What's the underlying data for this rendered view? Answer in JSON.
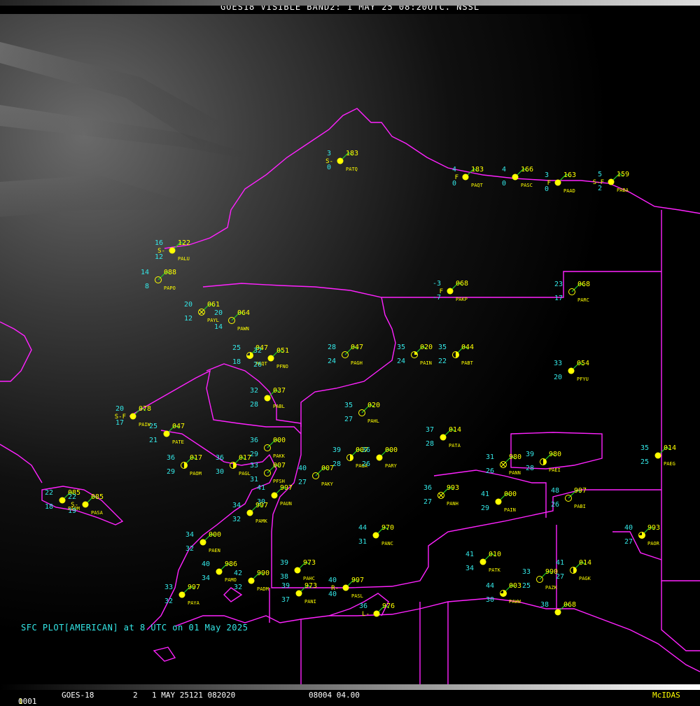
{
  "header": {
    "title": "GOES18  VISIBLE BAND2: 1 MAY 25 08:20UTC.  NSSL"
  },
  "caption": "SFC PLOT[AMERICAN] at 8 UTC on 01 May 2025",
  "status": {
    "frame": "0001",
    "satellite": "GOES-18",
    "band": "2",
    "date": "1 MAY 25121 082020",
    "time": "08004 04.00",
    "brand": "McIDAS"
  },
  "colors": {
    "temperature": "#34e8e8",
    "dewpoint": "#34e8e8",
    "pressure": "#ffff00",
    "station_id": "#ffff00",
    "wind_barb": "#22d022",
    "boundary": "#ff22ff",
    "station_dot": "#ffff00"
  },
  "stations": [
    {
      "id": "PATQ",
      "temp": "3",
      "dew": "0",
      "pres": "183",
      "wx": "S-",
      "cover": "full"
    },
    {
      "id": "PAQT",
      "temp": "4",
      "dew": "0",
      "pres": "183",
      "wx": "F",
      "cover": "full"
    },
    {
      "id": "PASC",
      "temp": "4",
      "dew": "0",
      "pres": "166",
      "wx": "",
      "cover": "full"
    },
    {
      "id": "PAAD",
      "temp": "3",
      "dew": "0",
      "pres": "163",
      "wx": "F",
      "cover": "full"
    },
    {
      "id": "PABA",
      "temp": "5",
      "dew": "2",
      "pres": "159",
      "wx": "S-F",
      "cover": "full"
    },
    {
      "id": "PALU",
      "temp": "16",
      "dew": "12",
      "pres": "122",
      "wx": "S-",
      "cover": "full"
    },
    {
      "id": "PAPO",
      "temp": "14",
      "dew": "8",
      "pres": "088",
      "wx": "",
      "cover": "empty"
    },
    {
      "id": "PAKP",
      "temp": "-3",
      "dew": "-7",
      "pres": "068",
      "wx": "F",
      "cover": "full"
    },
    {
      "id": "PARC",
      "temp": "23",
      "dew": "17",
      "pres": "068",
      "wx": "",
      "cover": "empty"
    },
    {
      "id": "PAYL",
      "temp": "20",
      "dew": "12",
      "pres": "061",
      "wx": "",
      "cover": "x"
    },
    {
      "id": "PAWN",
      "temp": "20",
      "dew": "14",
      "pres": "064",
      "wx": "",
      "cover": "empty"
    },
    {
      "id": "PAQT",
      "temp": "25",
      "dew": "18",
      "pres": "047",
      "wx": "",
      "cover": "three"
    },
    {
      "id": "PFNO",
      "temp": "32",
      "dew": "26",
      "pres": "051",
      "wx": "",
      "cover": "full"
    },
    {
      "id": "PAGH",
      "temp": "28",
      "dew": "24",
      "pres": "047",
      "wx": "",
      "cover": "empty"
    },
    {
      "id": "PAIN",
      "temp": "35",
      "dew": "24",
      "pres": "020",
      "wx": "",
      "cover": "quarter"
    },
    {
      "id": "PABT",
      "temp": "35",
      "dew": "22",
      "pres": "044",
      "wx": "",
      "cover": "half"
    },
    {
      "id": "PFYU",
      "temp": "33",
      "dew": "20",
      "pres": "054",
      "wx": "",
      "cover": "full"
    },
    {
      "id": "PABL",
      "temp": "32",
      "dew": "28",
      "pres": "037",
      "wx": "",
      "cover": "full"
    },
    {
      "id": "PAHL",
      "temp": "35",
      "dew": "27",
      "pres": "020",
      "wx": "",
      "cover": "empty"
    },
    {
      "id": "PAIW",
      "temp": "20",
      "dew": "17",
      "pres": "078",
      "wx": "S-F",
      "cover": "full"
    },
    {
      "id": "PATE",
      "temp": "25",
      "dew": "21",
      "pres": "047",
      "wx": "",
      "cover": "full"
    },
    {
      "id": "PATA",
      "temp": "37",
      "dew": "28",
      "pres": "014",
      "wx": "",
      "cover": "full"
    },
    {
      "id": "PAKK",
      "temp": "36",
      "dew": "29",
      "pres": "000",
      "wx": "",
      "cover": "empty"
    },
    {
      "id": "PAOM",
      "temp": "36",
      "dew": "29",
      "pres": "017",
      "wx": "",
      "cover": "half"
    },
    {
      "id": "PAGL",
      "temp": "36",
      "dew": "30",
      "pres": "017",
      "wx": "",
      "cover": "half"
    },
    {
      "id": "PFSH",
      "temp": "33",
      "dew": "31",
      "pres": "007",
      "wx": "",
      "cover": "empty"
    },
    {
      "id": "PAGA",
      "temp": "39",
      "dew": "28",
      "pres": "007",
      "wx": "",
      "cover": "half"
    },
    {
      "id": "PARY",
      "temp": "36",
      "dew": "26",
      "pres": "000",
      "wx": "",
      "cover": "full"
    },
    {
      "id": "PAKY",
      "temp": "40",
      "dew": "27",
      "pres": "007",
      "wx": "",
      "cover": "empty"
    },
    {
      "id": "PANN",
      "temp": "31",
      "dew": "26",
      "pres": "980",
      "wx": "",
      "cover": "x"
    },
    {
      "id": "PAEI",
      "temp": "39",
      "dew": "28",
      "pres": "980",
      "wx": "",
      "cover": "half"
    },
    {
      "id": "PAEG",
      "temp": "35",
      "dew": "25",
      "pres": "014",
      "wx": "",
      "cover": "full"
    },
    {
      "id": "PAUN",
      "temp": "41",
      "dew": "30",
      "pres": "997",
      "wx": "",
      "cover": "full"
    },
    {
      "id": "PANH",
      "temp": "36",
      "dew": "27",
      "pres": "993",
      "wx": "",
      "cover": "x"
    },
    {
      "id": "PABI",
      "temp": "48",
      "dew": "26",
      "pres": "997",
      "wx": "",
      "cover": "empty"
    },
    {
      "id": "PAIN",
      "temp": "41",
      "dew": "29",
      "pres": "000",
      "wx": "",
      "cover": "full"
    },
    {
      "id": "PAOM",
      "temp": "22",
      "dew": "18",
      "pres": "085",
      "wx": "",
      "cover": "full"
    },
    {
      "id": "PASA",
      "temp": "22",
      "dew": "19",
      "pres": "085",
      "wx": "S-",
      "cover": "full"
    },
    {
      "id": "PAMK",
      "temp": "34",
      "dew": "32",
      "pres": "997",
      "wx": "",
      "cover": "full"
    },
    {
      "id": "PANC",
      "temp": "44",
      "dew": "31",
      "pres": "970",
      "wx": "",
      "cover": "full"
    },
    {
      "id": "PAOR",
      "temp": "40",
      "dew": "27",
      "pres": "993",
      "wx": "",
      "cover": "three"
    },
    {
      "id": "PAEN",
      "temp": "34",
      "dew": "32",
      "pres": "000",
      "wx": "",
      "cover": "full"
    },
    {
      "id": "PAMO",
      "temp": "40",
      "dew": "34",
      "pres": "986",
      "wx": "",
      "cover": "full"
    },
    {
      "id": "PADM",
      "temp": "42",
      "dew": "32",
      "pres": "990",
      "wx": "",
      "cover": "full"
    },
    {
      "id": "PAHC",
      "temp": "39",
      "dew": "38",
      "pres": "973",
      "wx": "",
      "cover": "full"
    },
    {
      "id": "PATK",
      "temp": "41",
      "dew": "34",
      "pres": "010",
      "wx": "",
      "cover": "full"
    },
    {
      "id": "PAZK",
      "temp": "33",
      "dew": "25",
      "pres": "990",
      "wx": "",
      "cover": "empty"
    },
    {
      "id": "PAGK",
      "temp": "41",
      "dew": "27",
      "pres": "014",
      "wx": "",
      "cover": "half"
    },
    {
      "id": "PAYA",
      "temp": "33",
      "dew": "32",
      "pres": "997",
      "wx": "",
      "cover": "full"
    },
    {
      "id": "PANI",
      "temp": "39",
      "dew": "37",
      "pres": "973",
      "wx": "",
      "cover": "full"
    },
    {
      "id": "PASL",
      "temp": "40",
      "dew": "40",
      "pres": "997",
      "wx": "R-",
      "cover": "full"
    },
    {
      "id": "PAWW",
      "temp": "44",
      "dew": "30",
      "pres": "003",
      "wx": "",
      "cover": "three"
    },
    {
      "id": "",
      "temp": "36",
      "dew": "",
      "pres": "976",
      "wx": "L-",
      "cover": "full"
    },
    {
      "id": "",
      "temp": "38",
      "dew": "",
      "pres": "068",
      "wx": "",
      "cover": "full"
    }
  ]
}
